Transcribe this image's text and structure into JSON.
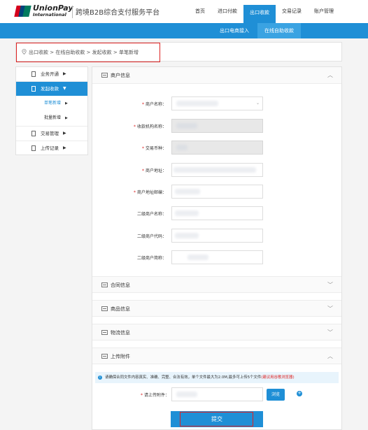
{
  "header": {
    "logo": {
      "brand": "UnionPay",
      "sub": "International"
    },
    "platform_title": "跨境B2B综合支付服务平台",
    "nav": [
      {
        "label": "首页"
      },
      {
        "label": "进口付款"
      },
      {
        "label": "出口收款",
        "active": true
      },
      {
        "label": "交易记录"
      },
      {
        "label": "账户管理"
      }
    ],
    "subnav": [
      {
        "label": "出口电商接入"
      },
      {
        "label": "在线自助收款",
        "active": true
      }
    ]
  },
  "breadcrumb": "出口收款 > 在线自助收款 > 发起收款 > 单笔新增",
  "sidebar": {
    "items": [
      {
        "label": "业务开通",
        "caret": "▶"
      },
      {
        "label": "发起收款",
        "caret": "▼"
      },
      {
        "label": "单笔新增",
        "caret": "▶"
      },
      {
        "label": "批量新增",
        "caret": "▶"
      },
      {
        "label": "交易管理",
        "caret": "▶"
      },
      {
        "label": "上传记录",
        "caret": "▶"
      }
    ]
  },
  "main": {
    "sections": {
      "merchant": "商户信息",
      "contract": "合同信息",
      "goods": "商品信息",
      "logistics": "物流信息",
      "attachment": "上传附件"
    },
    "fields": [
      {
        "label": "商户名称：",
        "required": true
      },
      {
        "label": "收款机构名称：",
        "required": true
      },
      {
        "label": "交易币种：",
        "required": true
      },
      {
        "label": "商户地址：",
        "required": true
      },
      {
        "label": "商户地址邮编：",
        "required": true
      },
      {
        "label": "二级商户名称：",
        "required": false
      },
      {
        "label": "二级商户代码：",
        "required": false
      },
      {
        "label": "二级商户简称：",
        "required": false
      }
    ],
    "notice": {
      "text": "请确保合同文件内容真实、准确、完整、合法有效，单个文件最大为2.0M,最多可上传5个文件",
      "link": "(建议用谷歌浏览器)"
    },
    "upload": {
      "label": "请上传附件：",
      "browse": "浏览",
      "add": "+"
    },
    "submit": "提交"
  },
  "colors": {
    "primary": "#1f8fd6",
    "highlight_border": "#d22222"
  }
}
